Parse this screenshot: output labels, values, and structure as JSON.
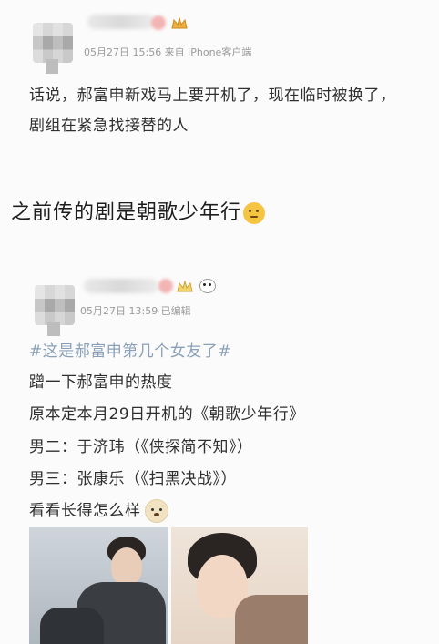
{
  "post1": {
    "meta_text": "05月27日 15:56  来自 iPhone客户端",
    "lines": [
      "话说，郝富申新戏马上要开机了，现在临时被换了，",
      "剧组在紧急找接替的人"
    ]
  },
  "comment": {
    "text": "之前传的剧是朝歌少年行",
    "emoji_icon": "thinking-emoji-icon"
  },
  "post2": {
    "meta_text": "05月27日 13:59  已编辑",
    "topic": "#这是郝富申第几个女友了#",
    "lines": [
      "蹭一下郝富申的热度",
      "原本定本月29日开机的《朝歌少年行》",
      "男二：于济玮（《侠探简不知》）",
      "男三：张康乐（《扫黑决战》）",
      "看看长得怎么样"
    ],
    "emoji_icon": "dog-emoji-icon"
  }
}
